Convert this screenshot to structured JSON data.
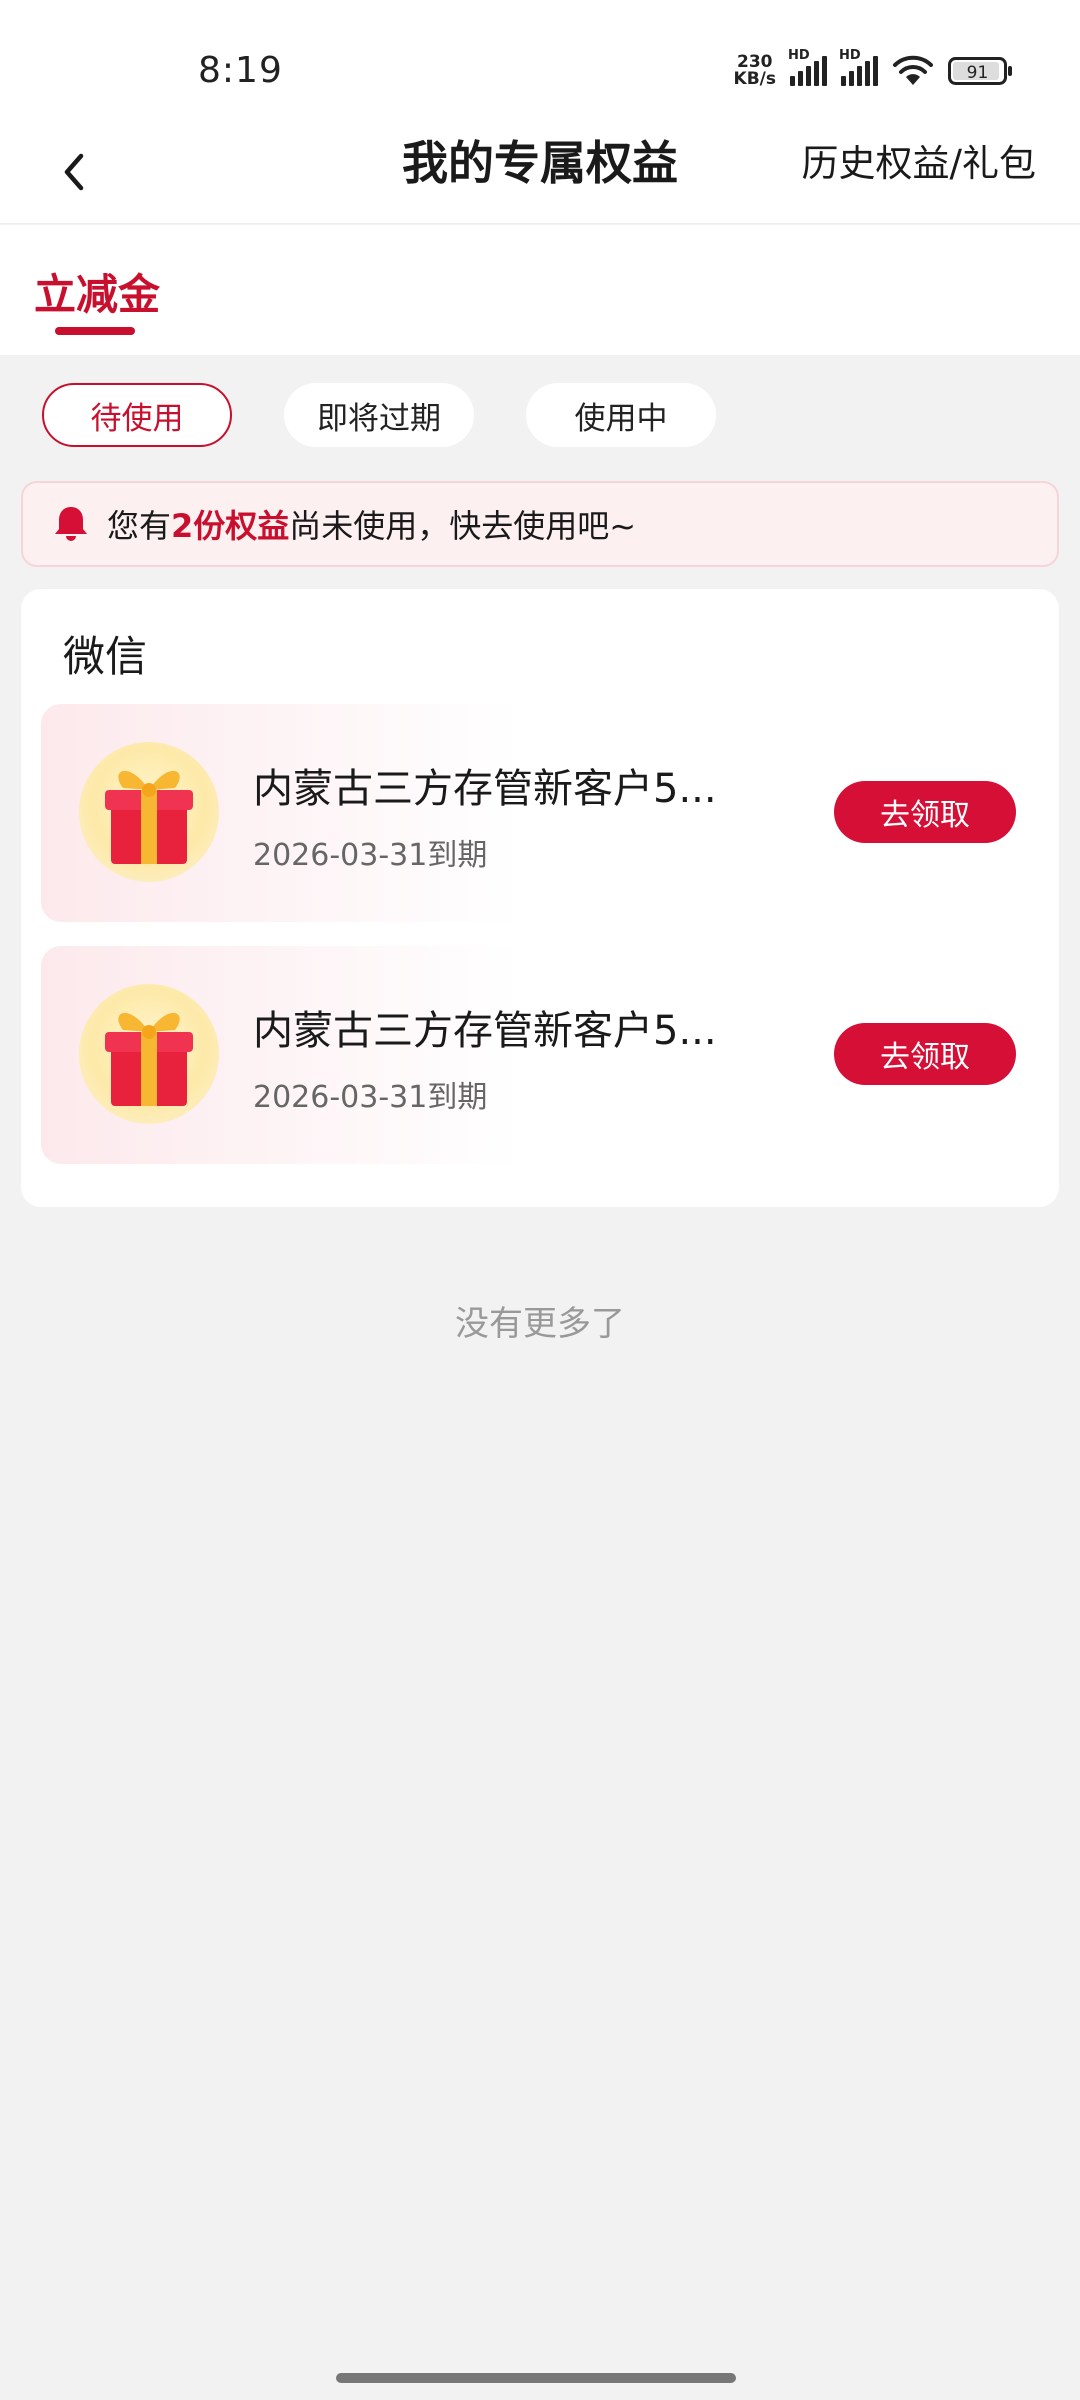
{
  "status_bar": {
    "time": "8:19",
    "net_speed_value": "230",
    "net_speed_unit": "KB/s",
    "sim1_label": "HD",
    "sim2_label": "HD",
    "battery": "91"
  },
  "header": {
    "back_icon": "chevron-left-icon",
    "title": "我的专属权益",
    "history_link": "历史权益/礼包"
  },
  "tabs": [
    {
      "label": "立减金",
      "active": true
    }
  ],
  "filters": [
    {
      "label": "待使用",
      "active": true
    },
    {
      "label": "即将过期",
      "active": false
    },
    {
      "label": "使用中",
      "active": false
    }
  ],
  "notice": {
    "icon": "bell-icon",
    "prefix": "您有",
    "highlight": "2份权益",
    "suffix": "尚未使用，快去使用吧~"
  },
  "section": {
    "title": "微信",
    "items": [
      {
        "icon": "gift-icon",
        "name": "内蒙古三方存管新客户5...",
        "expiry": "2026-03-31到期",
        "action": "去领取"
      },
      {
        "icon": "gift-icon",
        "name": "内蒙古三方存管新客户5...",
        "expiry": "2026-03-31到期",
        "action": "去领取"
      }
    ]
  },
  "footer_text": "没有更多了",
  "colors": {
    "accent": "#c8102e",
    "button": "#d50f36",
    "background": "#f2f2f2",
    "notice_bg": "#fdf0f1"
  }
}
